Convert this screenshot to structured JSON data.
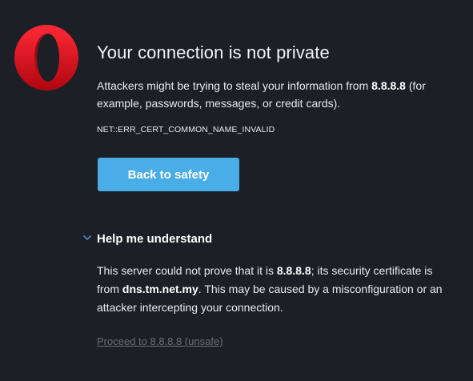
{
  "logo": {
    "icon": "opera-logo-icon",
    "color": "#e3141d"
  },
  "interstitial": {
    "title": "Your connection is not private",
    "description": {
      "before": "Attackers might be trying to steal your information from ",
      "host": "8.8.8.8",
      "after": " (for example, passwords, messages, or credit cards)."
    },
    "error_code": "NET::ERR_CERT_COMMON_NAME_INVALID",
    "back_button_label": "Back to safety",
    "back_button_color": "#49ade8"
  },
  "help": {
    "toggle_label": "Help me understand",
    "toggle_icon": "chevron-down-icon",
    "details": {
      "part1": "This server could not prove that it is ",
      "host": "8.8.8.8",
      "part2": "; its security certificate is from ",
      "cert_host": "dns.tm.net.my",
      "part3": ". This may be caused by a misconfiguration or an attacker intercepting your connection."
    },
    "proceed_link": "Proceed to 8.8.8.8 (unsafe)"
  }
}
